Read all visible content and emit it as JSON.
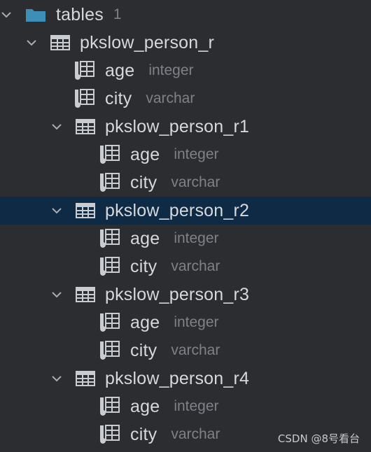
{
  "tree": {
    "root": {
      "label": "tables",
      "count": "1",
      "icon": "folder-icon"
    },
    "tables": [
      {
        "name": "pkslow_person_r",
        "selected": false,
        "columns": [
          {
            "name": "age",
            "type": "integer"
          },
          {
            "name": "city",
            "type": "varchar"
          }
        ]
      },
      {
        "name": "pkslow_person_r1",
        "selected": false,
        "columns": [
          {
            "name": "age",
            "type": "integer"
          },
          {
            "name": "city",
            "type": "varchar"
          }
        ]
      },
      {
        "name": "pkslow_person_r2",
        "selected": true,
        "columns": [
          {
            "name": "age",
            "type": "integer"
          },
          {
            "name": "city",
            "type": "varchar"
          }
        ]
      },
      {
        "name": "pkslow_person_r3",
        "selected": false,
        "columns": [
          {
            "name": "age",
            "type": "integer"
          },
          {
            "name": "city",
            "type": "varchar"
          }
        ]
      },
      {
        "name": "pkslow_person_r4",
        "selected": false,
        "columns": [
          {
            "name": "age",
            "type": "integer"
          },
          {
            "name": "city",
            "type": "varchar"
          }
        ]
      }
    ]
  },
  "watermark": "CSDN @8号看台",
  "colors": {
    "background": "#2b2d30",
    "selected_row": "#0f2a44",
    "folder": "#3d8fb8",
    "text": "#d6d8dc",
    "type_text": "#7e8187"
  }
}
